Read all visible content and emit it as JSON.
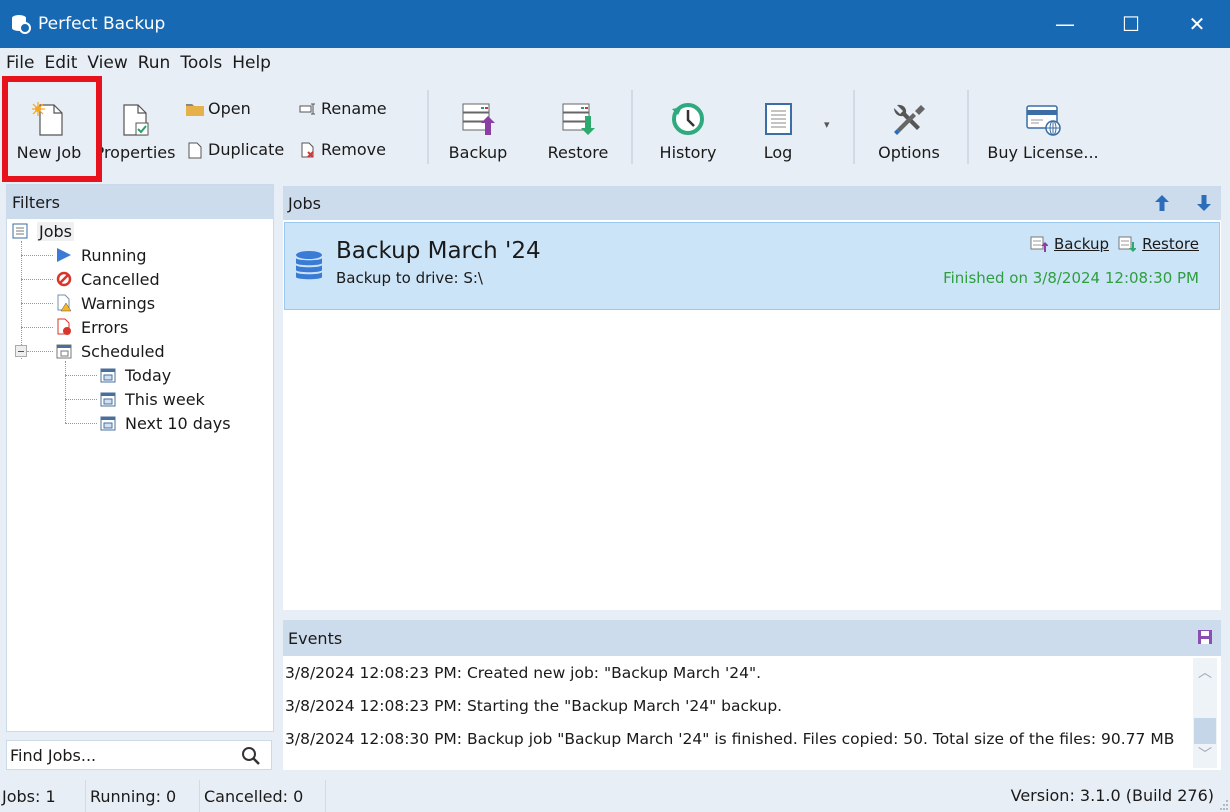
{
  "window": {
    "title": "Perfect Backup",
    "app_icon": "database-sync-icon",
    "controls": {
      "minimize": "—",
      "maximize": "☐",
      "close": "✕"
    }
  },
  "menu": [
    "File",
    "Edit",
    "View",
    "Run",
    "Tools",
    "Help"
  ],
  "toolbar": {
    "new_job": {
      "label": "New Job",
      "icon": "new-document-icon"
    },
    "properties": {
      "label": "Properties",
      "icon": "document-check-icon"
    },
    "open": {
      "label": "Open",
      "icon": "folder-icon"
    },
    "duplicate": {
      "label": "Duplicate",
      "icon": "copy-icon"
    },
    "rename": {
      "label": "Rename",
      "icon": "rename-icon"
    },
    "remove": {
      "label": "Remove",
      "icon": "remove-icon"
    },
    "backup": {
      "label": "Backup",
      "icon": "server-upload-icon"
    },
    "restore": {
      "label": "Restore",
      "icon": "server-download-icon"
    },
    "history": {
      "label": "History",
      "icon": "history-clock-icon"
    },
    "log": {
      "label": "Log",
      "icon": "notebook-icon",
      "dropdown": "▾"
    },
    "options": {
      "label": "Options",
      "icon": "tools-icon"
    },
    "buy_license": {
      "label": "Buy License...",
      "icon": "credit-card-globe-icon"
    }
  },
  "filters": {
    "header": "Filters",
    "tree": [
      {
        "label": "Jobs",
        "icon": "list-icon",
        "level": 0
      },
      {
        "label": "Running",
        "icon": "play-icon",
        "level": 1
      },
      {
        "label": "Cancelled",
        "icon": "cancel-icon",
        "level": 1
      },
      {
        "label": "Warnings",
        "icon": "warning-document-icon",
        "level": 1
      },
      {
        "label": "Errors",
        "icon": "error-document-icon",
        "level": 1
      },
      {
        "label": "Scheduled",
        "icon": "calendar-icon",
        "level": 1,
        "expanded": true
      },
      {
        "label": "Today",
        "icon": "calendar-icon",
        "level": 2
      },
      {
        "label": "This week",
        "icon": "calendar-icon",
        "level": 2
      },
      {
        "label": "Next 10 days",
        "icon": "calendar-icon",
        "level": 2
      }
    ],
    "search_placeholder": "Find Jobs..."
  },
  "jobs": {
    "header": "Jobs",
    "items": [
      {
        "name": "Backup March '24",
        "description": "Backup to drive: S:\\",
        "backup_link": "Backup",
        "restore_link": "Restore",
        "status": "Finished on 3/8/2024 12:08:30 PM"
      }
    ]
  },
  "events": {
    "header": "Events",
    "lines": [
      "3/8/2024 12:08:23 PM: Created new job: \"Backup March '24\".",
      "3/8/2024 12:08:23 PM: Starting the \"Backup March '24\" backup.",
      "3/8/2024 12:08:30 PM: Backup job \"Backup March '24\" is finished. Files copied: 50. Total size of the files: 90.77 MB"
    ]
  },
  "statusbar": {
    "jobs": "Jobs: 1",
    "running": "Running: 0",
    "cancelled": "Cancelled: 0",
    "version": "Version: 3.1.0 (Build 276)"
  },
  "colors": {
    "titlebar": "#1769b4",
    "highlight": "#e8121c",
    "selection": "#cce4f7",
    "status_ok": "#2e9e3e"
  }
}
